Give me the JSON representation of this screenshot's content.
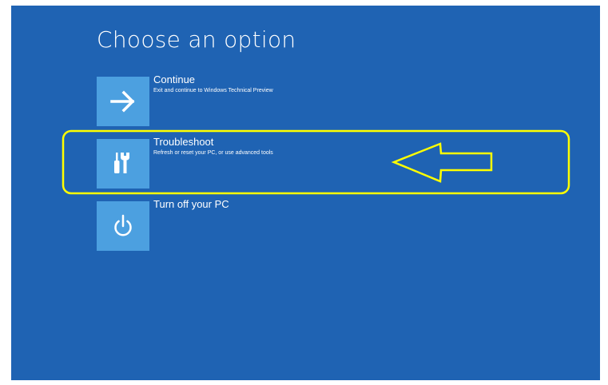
{
  "screen": {
    "title": "Choose an option",
    "background_color": "#1f63b3",
    "tile_color": "#4ca0e0"
  },
  "options": [
    {
      "label": "Continue",
      "description": "Exit and continue to Windows Technical Preview",
      "icon": "arrow-right-icon"
    },
    {
      "label": "Troubleshoot",
      "description": "Refresh or reset your PC, or use advanced tools",
      "icon": "tools-icon"
    },
    {
      "label": "Turn off your PC",
      "description": "",
      "icon": "power-icon"
    }
  ],
  "annotation": {
    "color": "#ffff00",
    "shape": "rounded-rectangle-highlight-with-left-arrow"
  }
}
